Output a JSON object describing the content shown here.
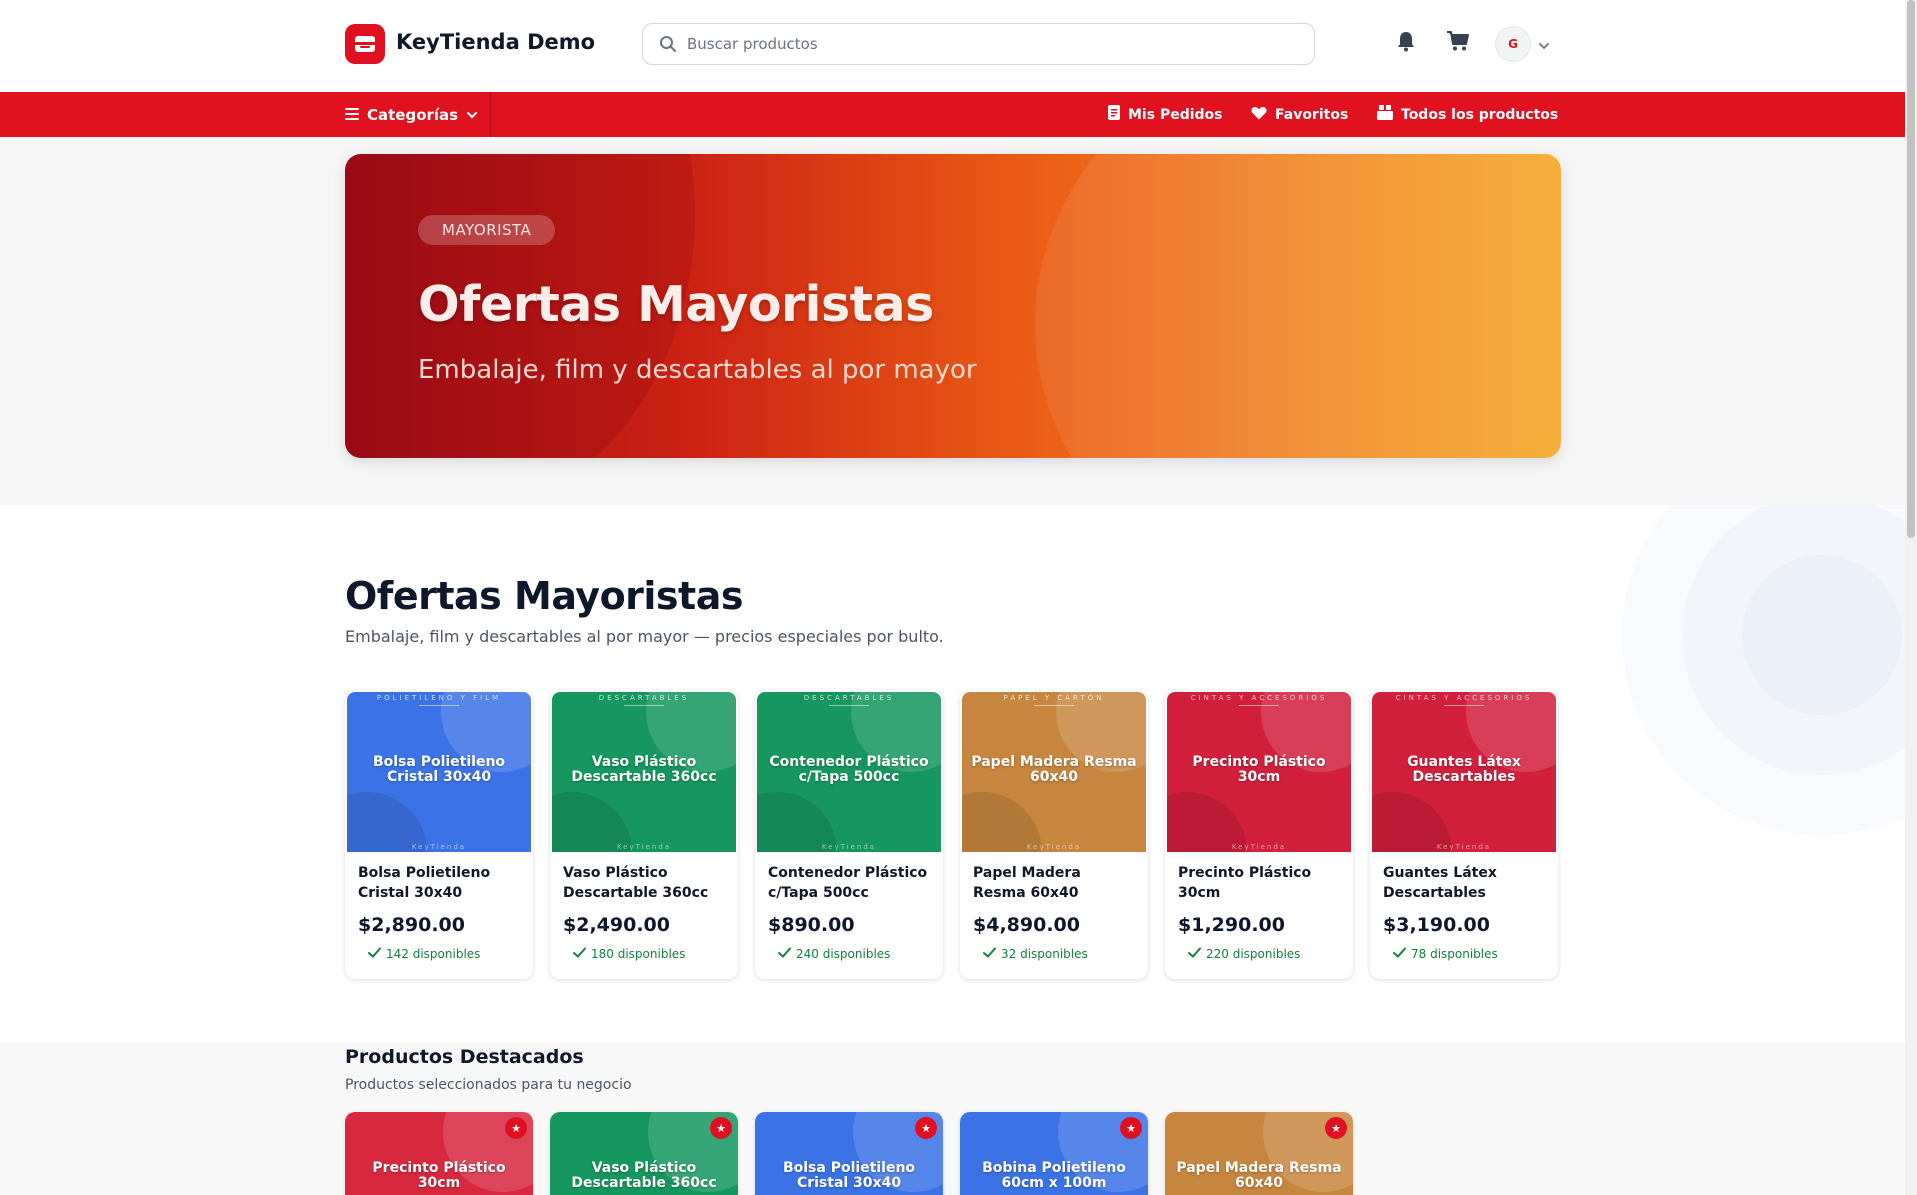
{
  "header": {
    "brand_name": "KeyTienda Demo",
    "search_placeholder": "Buscar productos",
    "avatar_initial": "G",
    "icons": [
      "store-icon",
      "search-icon",
      "bell-icon",
      "cart-icon",
      "chevron-down-icon"
    ]
  },
  "navbar": {
    "categories_label": "Categorías",
    "links": [
      {
        "label": "Mis Pedidos",
        "icon": "orders-icon"
      },
      {
        "label": "Favoritos",
        "icon": "heart-icon"
      },
      {
        "label": "Todos los productos",
        "icon": "products-icon"
      }
    ]
  },
  "hero": {
    "badge": "MAYORISTA",
    "title": "Ofertas Mayoristas",
    "subtitle": "Embalaje, film y descartables al por mayor"
  },
  "wholesale": {
    "title": "Ofertas Mayoristas",
    "subtitle": "Embalaje, film y descartables al por mayor — precios especiales por bulto.",
    "watermark": "KeyTienda",
    "products": [
      {
        "category": "POLIETILENO Y FILM",
        "image_title": "Bolsa Polietileno Cristal 30x40",
        "name": "Bolsa Polietileno Cristal 30x40",
        "price": "$2,890.00",
        "stock": "142 disponibles",
        "color": "#3b73e6"
      },
      {
        "category": "DESCARTABLES",
        "image_title": "Vaso Plástico Descartable 360cc",
        "name": "Vaso Plástico Descartable 360cc",
        "price": "$2,490.00",
        "stock": "180 disponibles",
        "color": "#16975f"
      },
      {
        "category": "DESCARTABLES",
        "image_title": "Contenedor Plástico c/Tapa 500cc",
        "name": "Contenedor Plástico c/Tapa 500cc",
        "price": "$890.00",
        "stock": "240 disponibles",
        "color": "#16975f"
      },
      {
        "category": "PAPEL Y CARTÓN",
        "image_title": "Papel Madera Resma 60x40",
        "name": "Papel Madera Resma 60x40",
        "price": "$4,890.00",
        "stock": "32 disponibles",
        "color": "#c7863f"
      },
      {
        "category": "CINTAS Y ACCESORIOS",
        "image_title": "Precinto Plástico 30cm",
        "name": "Precinto Plástico 30cm",
        "price": "$1,290.00",
        "stock": "220 disponibles",
        "color": "#d21f3c"
      },
      {
        "category": "CINTAS Y ACCESORIOS",
        "image_title": "Guantes Látex Descartables",
        "name": "Guantes Látex Descartables",
        "price": "$3,190.00",
        "stock": "78 disponibles",
        "color": "#d21f3c"
      }
    ]
  },
  "featured": {
    "title": "Productos Destacados",
    "subtitle": "Productos seleccionados para tu negocio",
    "products": [
      {
        "image_title": "Precinto Plástico 30cm",
        "color": "#d8283f"
      },
      {
        "image_title": "Vaso Plástico Descartable 360cc",
        "color": "#16975f"
      },
      {
        "image_title": "Bolsa Polietileno Cristal 30x40",
        "color": "#3b73e6"
      },
      {
        "image_title": "Bobina Polietileno 60cm x 100m",
        "color": "#3b73e6"
      },
      {
        "image_title": "Papel Madera Resma 60x40",
        "color": "#c7863f"
      }
    ]
  }
}
